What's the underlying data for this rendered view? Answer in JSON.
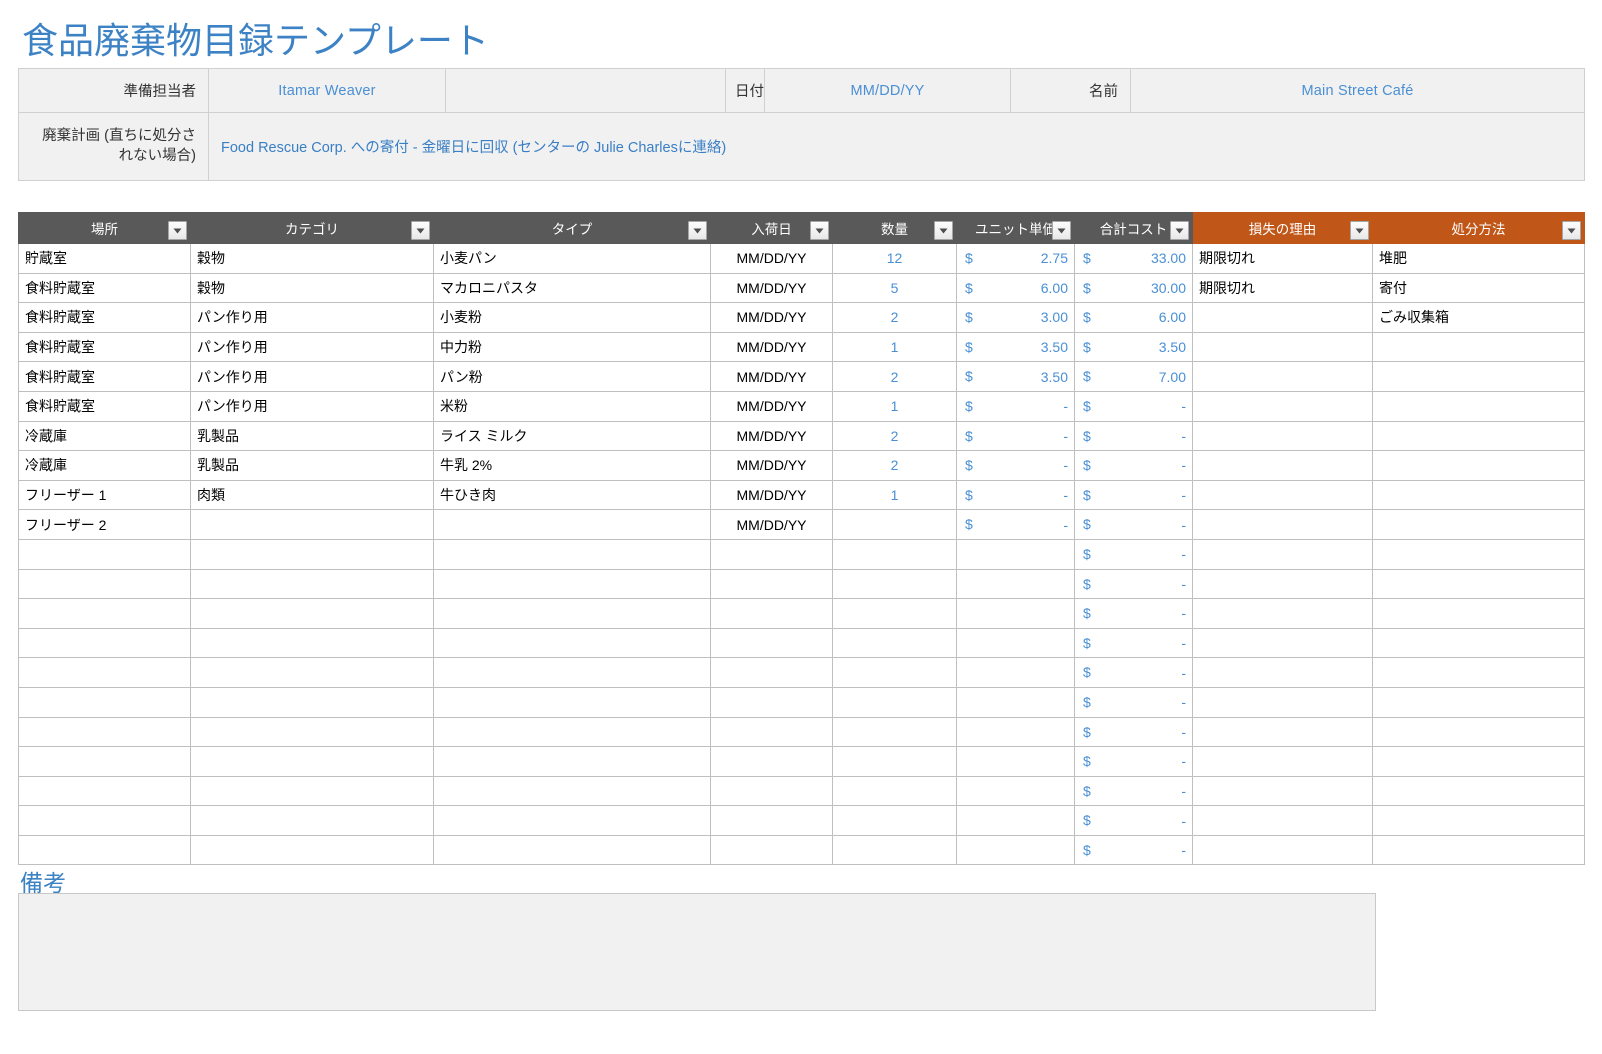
{
  "title": "食品廃棄物目録テンプレート",
  "info": {
    "prepared_by_label": "準備担当者",
    "prepared_by_value": "Itamar Weaver",
    "date_label": "日付",
    "date_value": "MM/DD/YY",
    "name_label": "名前",
    "name_value": "Main Street Café",
    "plan_label": "廃棄計画 (直ちに処分されない場合)",
    "plan_value": "Food Rescue Corp. への寄付 - 金曜日に回収 (センターの Julie Charlesに連絡)"
  },
  "table": {
    "columns": [
      {
        "label": "場所",
        "orange": false,
        "filter": true,
        "filter_side": "right"
      },
      {
        "label": "カテゴリ",
        "orange": false,
        "filter": true,
        "filter_side": "right"
      },
      {
        "label": "タイプ",
        "orange": false,
        "filter": true,
        "filter_side": "right"
      },
      {
        "label": "入荷日",
        "orange": false,
        "filter": true,
        "filter_side": "right"
      },
      {
        "label": "数量",
        "orange": false,
        "filter": true,
        "filter_side": "right"
      },
      {
        "label": "ユニット単価",
        "orange": false,
        "filter": true,
        "filter_side": "right"
      },
      {
        "label": "合計コスト",
        "orange": false,
        "filter": true,
        "filter_side": "right"
      },
      {
        "label": "損失の理由",
        "orange": true,
        "filter": true,
        "filter_side": "right"
      },
      {
        "label": "処分方法",
        "orange": true,
        "filter": true,
        "filter_side": "right"
      }
    ],
    "currency_symbol": "$",
    "rows": [
      {
        "location": "貯蔵室",
        "category": "穀物",
        "type": "小麦パン",
        "date": "MM/DD/YY",
        "qty": "12",
        "unit_price": "2.75",
        "total_cost": "33.00",
        "reason": "期限切れ",
        "disposal": "堆肥"
      },
      {
        "location": "食料貯蔵室",
        "category": "穀物",
        "type": "マカロニパスタ",
        "date": "MM/DD/YY",
        "qty": "5",
        "unit_price": "6.00",
        "total_cost": "30.00",
        "reason": "期限切れ",
        "disposal": "寄付"
      },
      {
        "location": "食料貯蔵室",
        "category": "パン作り用",
        "type": "小麦粉",
        "date": "MM/DD/YY",
        "qty": "2",
        "unit_price": "3.00",
        "total_cost": "6.00",
        "reason": "",
        "disposal": "ごみ収集箱"
      },
      {
        "location": "食料貯蔵室",
        "category": "パン作り用",
        "type": "中力粉",
        "date": "MM/DD/YY",
        "qty": "1",
        "unit_price": "3.50",
        "total_cost": "3.50",
        "reason": "",
        "disposal": ""
      },
      {
        "location": "食料貯蔵室",
        "category": "パン作り用",
        "type": "パン粉",
        "date": "MM/DD/YY",
        "qty": "2",
        "unit_price": "3.50",
        "total_cost": "7.00",
        "reason": "",
        "disposal": ""
      },
      {
        "location": "食料貯蔵室",
        "category": "パン作り用",
        "type": "米粉",
        "date": "MM/DD/YY",
        "qty": "1",
        "unit_price": "-",
        "total_cost": "-",
        "reason": "",
        "disposal": ""
      },
      {
        "location": "冷蔵庫",
        "category": "乳製品",
        "type": "ライス ミルク",
        "date": "MM/DD/YY",
        "qty": "2",
        "unit_price": "-",
        "total_cost": "-",
        "reason": "",
        "disposal": ""
      },
      {
        "location": "冷蔵庫",
        "category": "乳製品",
        "type": "牛乳 2%",
        "date": "MM/DD/YY",
        "qty": "2",
        "unit_price": "-",
        "total_cost": "-",
        "reason": "",
        "disposal": ""
      },
      {
        "location": "フリーザー 1",
        "category": "肉類",
        "type": "牛ひき肉",
        "date": "MM/DD/YY",
        "qty": "1",
        "unit_price": "-",
        "total_cost": "-",
        "reason": "",
        "disposal": ""
      },
      {
        "location": "フリーザー 2",
        "category": "",
        "type": "",
        "date": "MM/DD/YY",
        "qty": "",
        "unit_price": "-",
        "total_cost": "-",
        "reason": "",
        "disposal": ""
      },
      {
        "location": "",
        "category": "",
        "type": "",
        "date": "",
        "qty": "",
        "unit_price": "",
        "total_cost": "-",
        "reason": "",
        "disposal": ""
      },
      {
        "location": "",
        "category": "",
        "type": "",
        "date": "",
        "qty": "",
        "unit_price": "",
        "total_cost": "-",
        "reason": "",
        "disposal": ""
      },
      {
        "location": "",
        "category": "",
        "type": "",
        "date": "",
        "qty": "",
        "unit_price": "",
        "total_cost": "-",
        "reason": "",
        "disposal": ""
      },
      {
        "location": "",
        "category": "",
        "type": "",
        "date": "",
        "qty": "",
        "unit_price": "",
        "total_cost": "-",
        "reason": "",
        "disposal": ""
      },
      {
        "location": "",
        "category": "",
        "type": "",
        "date": "",
        "qty": "",
        "unit_price": "",
        "total_cost": "-",
        "reason": "",
        "disposal": ""
      },
      {
        "location": "",
        "category": "",
        "type": "",
        "date": "",
        "qty": "",
        "unit_price": "",
        "total_cost": "-",
        "reason": "",
        "disposal": ""
      },
      {
        "location": "",
        "category": "",
        "type": "",
        "date": "",
        "qty": "",
        "unit_price": "",
        "total_cost": "-",
        "reason": "",
        "disposal": ""
      },
      {
        "location": "",
        "category": "",
        "type": "",
        "date": "",
        "qty": "",
        "unit_price": "",
        "total_cost": "-",
        "reason": "",
        "disposal": ""
      },
      {
        "location": "",
        "category": "",
        "type": "",
        "date": "",
        "qty": "",
        "unit_price": "",
        "total_cost": "-",
        "reason": "",
        "disposal": ""
      },
      {
        "location": "",
        "category": "",
        "type": "",
        "date": "",
        "qty": "",
        "unit_price": "",
        "total_cost": "-",
        "reason": "",
        "disposal": ""
      },
      {
        "location": "",
        "category": "",
        "type": "",
        "date": "",
        "qty": "",
        "unit_price": "",
        "total_cost": "-",
        "reason": "",
        "disposal": ""
      }
    ]
  },
  "notes": {
    "label": "備考",
    "value": ""
  },
  "colors": {
    "accent_blue": "#3C82C4",
    "value_blue": "#4A8FD4",
    "header_grey": "#595959",
    "header_orange": "#C05617",
    "peach_fill": "#FBE2D5",
    "panel_grey": "#F1F1F1"
  }
}
